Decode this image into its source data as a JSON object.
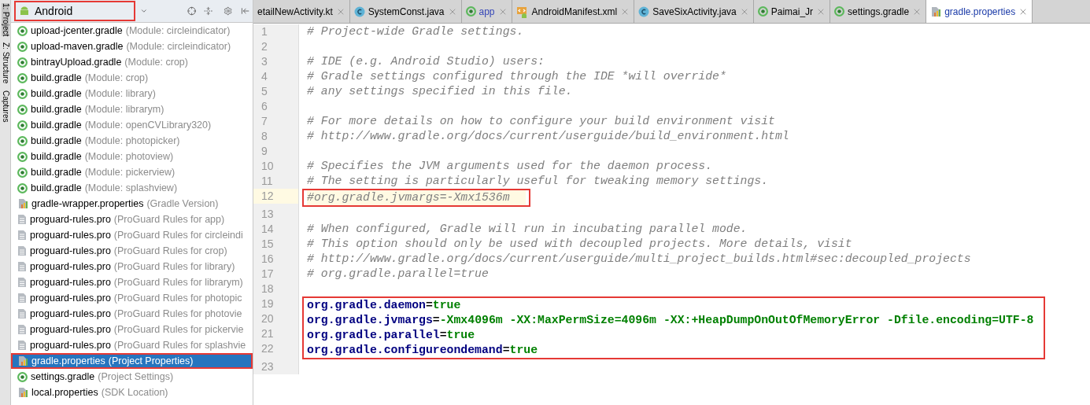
{
  "sidebar": {
    "side_tabs": [
      {
        "label": "1: Project",
        "selected": true
      },
      {
        "label": "Z: Structure",
        "selected": false
      },
      {
        "label": "Captures",
        "selected": false
      }
    ],
    "view_selector": {
      "label": "Android",
      "highlighted": true
    },
    "items": [
      {
        "name": "upload-jcenter.gradle",
        "detail": "(Module: circleindicator)",
        "kind": "gradle",
        "selected": false,
        "highlighted": false
      },
      {
        "name": "upload-maven.gradle",
        "detail": "(Module: circleindicator)",
        "kind": "gradle",
        "selected": false,
        "highlighted": false
      },
      {
        "name": "bintrayUpload.gradle",
        "detail": "(Module: crop)",
        "kind": "gradle",
        "selected": false,
        "highlighted": false
      },
      {
        "name": "build.gradle",
        "detail": "(Module: crop)",
        "kind": "gradle",
        "selected": false,
        "highlighted": false
      },
      {
        "name": "build.gradle",
        "detail": "(Module: library)",
        "kind": "gradle",
        "selected": false,
        "highlighted": false
      },
      {
        "name": "build.gradle",
        "detail": "(Module: librarym)",
        "kind": "gradle",
        "selected": false,
        "highlighted": false
      },
      {
        "name": "build.gradle",
        "detail": "(Module: openCVLibrary320)",
        "kind": "gradle",
        "selected": false,
        "highlighted": false
      },
      {
        "name": "build.gradle",
        "detail": "(Module: photopicker)",
        "kind": "gradle",
        "selected": false,
        "highlighted": false
      },
      {
        "name": "build.gradle",
        "detail": "(Module: photoview)",
        "kind": "gradle",
        "selected": false,
        "highlighted": false
      },
      {
        "name": "build.gradle",
        "detail": "(Module: pickerview)",
        "kind": "gradle",
        "selected": false,
        "highlighted": false
      },
      {
        "name": "build.gradle",
        "detail": "(Module: splashview)",
        "kind": "gradle",
        "selected": false,
        "highlighted": false
      },
      {
        "name": "gradle-wrapper.properties",
        "detail": "(Gradle Version)",
        "kind": "properties",
        "selected": false,
        "highlighted": false
      },
      {
        "name": "proguard-rules.pro",
        "detail": "(ProGuard Rules for app)",
        "kind": "text",
        "selected": false,
        "highlighted": false
      },
      {
        "name": "proguard-rules.pro",
        "detail": "(ProGuard Rules for circleindi",
        "kind": "text",
        "selected": false,
        "highlighted": false
      },
      {
        "name": "proguard-rules.pro",
        "detail": "(ProGuard Rules for crop)",
        "kind": "text",
        "selected": false,
        "highlighted": false
      },
      {
        "name": "proguard-rules.pro",
        "detail": "(ProGuard Rules for library)",
        "kind": "text",
        "selected": false,
        "highlighted": false
      },
      {
        "name": "proguard-rules.pro",
        "detail": "(ProGuard Rules for librarym)",
        "kind": "text",
        "selected": false,
        "highlighted": false
      },
      {
        "name": "proguard-rules.pro",
        "detail": "(ProGuard Rules for photopic",
        "kind": "text",
        "selected": false,
        "highlighted": false
      },
      {
        "name": "proguard-rules.pro",
        "detail": "(ProGuard Rules for photovie",
        "kind": "text",
        "selected": false,
        "highlighted": false
      },
      {
        "name": "proguard-rules.pro",
        "detail": "(ProGuard Rules for pickervie",
        "kind": "text",
        "selected": false,
        "highlighted": false
      },
      {
        "name": "proguard-rules.pro",
        "detail": "(ProGuard Rules for splashvie",
        "kind": "text",
        "selected": false,
        "highlighted": false
      },
      {
        "name": "gradle.properties",
        "detail": "(Project Properties)",
        "kind": "properties",
        "selected": true,
        "highlighted": true
      },
      {
        "name": "settings.gradle",
        "detail": "(Project Settings)",
        "kind": "gradle",
        "selected": false,
        "highlighted": false
      },
      {
        "name": "local.properties",
        "detail": "(SDK Location)",
        "kind": "properties",
        "selected": false,
        "highlighted": false
      }
    ]
  },
  "tabs": [
    {
      "label": "etailNewActivity.kt",
      "kind": "none",
      "selected": false
    },
    {
      "label": "SystemConst.java",
      "kind": "class",
      "selected": false
    },
    {
      "label": "app",
      "kind": "gradle",
      "selected": false
    },
    {
      "label": "AndroidManifest.xml",
      "kind": "manifest",
      "selected": false
    },
    {
      "label": "SaveSixActivity.java",
      "kind": "class",
      "selected": false
    },
    {
      "label": "Paimai_Jr",
      "kind": "gradle",
      "selected": false
    },
    {
      "label": "settings.gradle",
      "kind": "gradle",
      "selected": false
    },
    {
      "label": "gradle.properties",
      "kind": "properties",
      "selected": true
    }
  ],
  "editor": {
    "blocks": [
      {
        "highlighted": false,
        "lines": [
          {
            "number": "1",
            "kind": "comment",
            "text": "# Project-wide Gradle settings.",
            "current": false
          },
          {
            "number": "2",
            "kind": "blank",
            "current": false
          },
          {
            "number": "3",
            "kind": "comment",
            "text": "# IDE (e.g. Android Studio) users:",
            "current": false
          },
          {
            "number": "4",
            "kind": "comment",
            "text": "# Gradle settings configured through the IDE *will override*",
            "current": false
          },
          {
            "number": "5",
            "kind": "comment",
            "text": "# any settings specified in this file.",
            "current": false
          },
          {
            "number": "6",
            "kind": "blank",
            "current": false
          },
          {
            "number": "7",
            "kind": "comment",
            "text": "# For more details on how to configure your build environment visit",
            "current": false
          },
          {
            "number": "8",
            "kind": "comment",
            "text": "# http://www.gradle.org/docs/current/userguide/build_environment.html",
            "current": false
          },
          {
            "number": "9",
            "kind": "blank",
            "current": false
          },
          {
            "number": "10",
            "kind": "comment",
            "text": "# Specifies the JVM arguments used for the daemon process.",
            "current": false
          },
          {
            "number": "11",
            "kind": "comment",
            "text": "# The setting is particularly useful for tweaking memory settings.",
            "current": false
          }
        ]
      },
      {
        "highlighted": true,
        "lines": [
          {
            "number": "12",
            "kind": "comment",
            "text": "#org.gradle.jvmargs=-Xmx1536m",
            "current": true
          }
        ]
      },
      {
        "highlighted": false,
        "lines": [
          {
            "number": "13",
            "kind": "blank",
            "current": false
          },
          {
            "number": "14",
            "kind": "comment",
            "text": "# When configured, Gradle will run in incubating parallel mode.",
            "current": false
          },
          {
            "number": "15",
            "kind": "comment",
            "text": "# This option should only be used with decoupled projects. More details, visit",
            "current": false
          },
          {
            "number": "16",
            "kind": "comment",
            "text": "# http://www.gradle.org/docs/current/userguide/multi_project_builds.html#sec:decoupled_projects",
            "current": false
          },
          {
            "number": "17",
            "kind": "comment",
            "text": "# org.gradle.parallel=true",
            "current": false
          },
          {
            "number": "18",
            "kind": "blank",
            "current": false
          }
        ]
      },
      {
        "highlighted": true,
        "lines": [
          {
            "number": "19",
            "kind": "property",
            "key": "org.gradle.daemon",
            "separator": "=",
            "value": "true",
            "current": false
          },
          {
            "number": "20",
            "kind": "property",
            "key": "org.gradle.jvmargs",
            "separator": "=",
            "value": "-Xmx4096m -XX:MaxPermSize=4096m -XX:+HeapDumpOnOutOfMemoryError -Dfile.encoding=UTF-8",
            "current": false
          },
          {
            "number": "21",
            "kind": "property",
            "key": "org.gradle.parallel",
            "separator": "=",
            "value": "true",
            "current": false
          },
          {
            "number": "22",
            "kind": "property",
            "key": "org.gradle.configureondemand",
            "separator": "=",
            "value": "true",
            "current": false
          }
        ]
      },
      {
        "highlighted": false,
        "lines": [
          {
            "number": "23",
            "kind": "blank",
            "current": false
          }
        ]
      }
    ]
  }
}
